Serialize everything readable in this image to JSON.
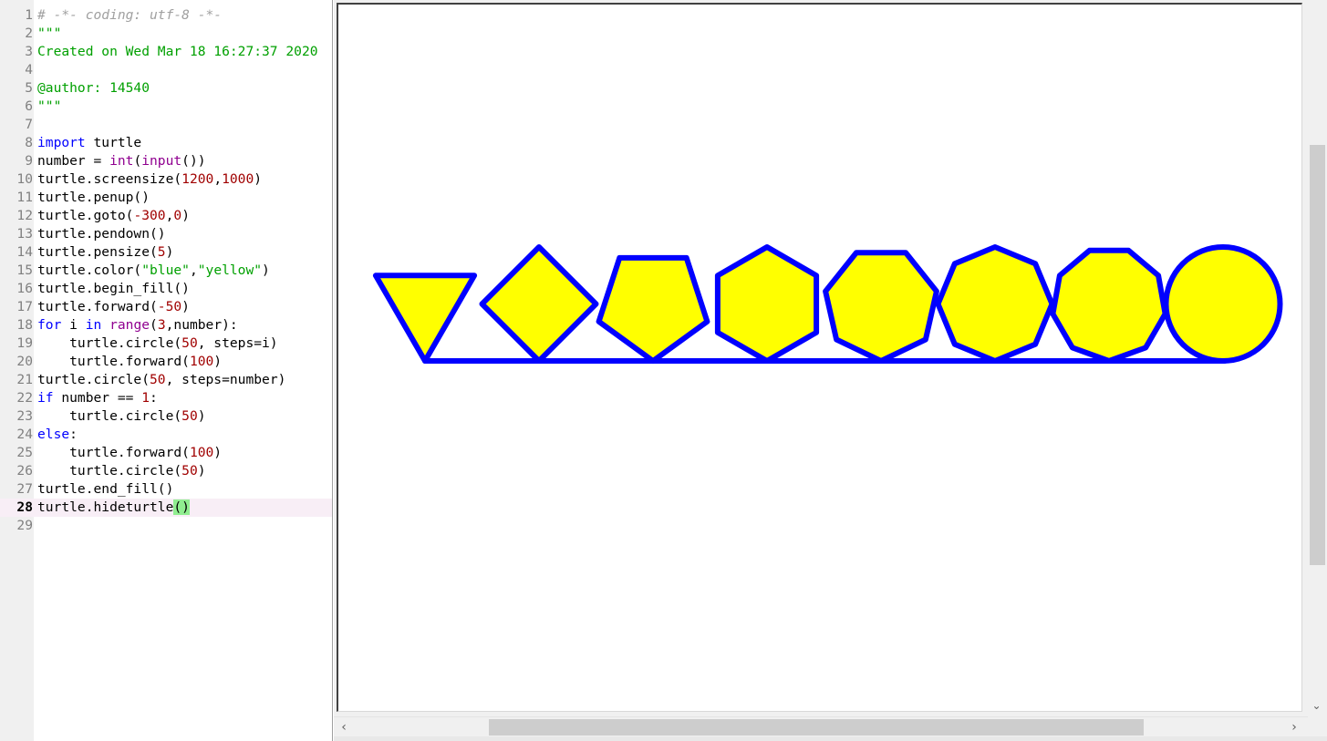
{
  "editor": {
    "current_line": 28,
    "lines": [
      {
        "n": "1",
        "tokens": [
          {
            "t": "# -*- coding: utf-8 -*-",
            "c": "comment"
          }
        ]
      },
      {
        "n": "2",
        "tokens": [
          {
            "t": "\"\"\"",
            "c": "doc"
          }
        ]
      },
      {
        "n": "3",
        "tokens": [
          {
            "t": "Created on Wed Mar 18 16:27:37 2020",
            "c": "doc"
          }
        ]
      },
      {
        "n": "4",
        "tokens": []
      },
      {
        "n": "5",
        "tokens": [
          {
            "t": "@author: 14540",
            "c": "doc"
          }
        ]
      },
      {
        "n": "6",
        "tokens": [
          {
            "t": "\"\"\"",
            "c": "doc"
          }
        ]
      },
      {
        "n": "7",
        "tokens": []
      },
      {
        "n": "8",
        "tokens": [
          {
            "t": "import",
            "c": "kw"
          },
          {
            "t": " turtle",
            "c": "plain"
          }
        ]
      },
      {
        "n": "9",
        "tokens": [
          {
            "t": "number = ",
            "c": "plain"
          },
          {
            "t": "int",
            "c": "builtin"
          },
          {
            "t": "(",
            "c": "plain"
          },
          {
            "t": "input",
            "c": "builtin"
          },
          {
            "t": "())",
            "c": "plain"
          }
        ]
      },
      {
        "n": "10",
        "tokens": [
          {
            "t": "turtle.screensize(",
            "c": "plain"
          },
          {
            "t": "1200",
            "c": "num"
          },
          {
            "t": ",",
            "c": "plain"
          },
          {
            "t": "1000",
            "c": "num"
          },
          {
            "t": ")",
            "c": "plain"
          }
        ]
      },
      {
        "n": "11",
        "tokens": [
          {
            "t": "turtle.penup()",
            "c": "plain"
          }
        ]
      },
      {
        "n": "12",
        "tokens": [
          {
            "t": "turtle.goto(",
            "c": "plain"
          },
          {
            "t": "-300",
            "c": "num"
          },
          {
            "t": ",",
            "c": "plain"
          },
          {
            "t": "0",
            "c": "num"
          },
          {
            "t": ")",
            "c": "plain"
          }
        ]
      },
      {
        "n": "13",
        "tokens": [
          {
            "t": "turtle.pendown()",
            "c": "plain"
          }
        ]
      },
      {
        "n": "14",
        "tokens": [
          {
            "t": "turtle.pensize(",
            "c": "plain"
          },
          {
            "t": "5",
            "c": "num"
          },
          {
            "t": ")",
            "c": "plain"
          }
        ]
      },
      {
        "n": "15",
        "tokens": [
          {
            "t": "turtle.color(",
            "c": "plain"
          },
          {
            "t": "\"blue\"",
            "c": "str"
          },
          {
            "t": ",",
            "c": "plain"
          },
          {
            "t": "\"yellow\"",
            "c": "str"
          },
          {
            "t": ")",
            "c": "plain"
          }
        ]
      },
      {
        "n": "16",
        "tokens": [
          {
            "t": "turtle.begin_fill()",
            "c": "plain"
          }
        ]
      },
      {
        "n": "17",
        "tokens": [
          {
            "t": "turtle.forward(",
            "c": "plain"
          },
          {
            "t": "-50",
            "c": "num"
          },
          {
            "t": ")",
            "c": "plain"
          }
        ]
      },
      {
        "n": "18",
        "tokens": [
          {
            "t": "for",
            "c": "kw"
          },
          {
            "t": " i ",
            "c": "plain"
          },
          {
            "t": "in",
            "c": "kw"
          },
          {
            "t": " ",
            "c": "plain"
          },
          {
            "t": "range",
            "c": "builtin"
          },
          {
            "t": "(",
            "c": "plain"
          },
          {
            "t": "3",
            "c": "num"
          },
          {
            "t": ",number):",
            "c": "plain"
          }
        ]
      },
      {
        "n": "19",
        "tokens": [
          {
            "t": "    turtle.circle(",
            "c": "plain"
          },
          {
            "t": "50",
            "c": "num"
          },
          {
            "t": ", steps=i)",
            "c": "plain"
          }
        ]
      },
      {
        "n": "20",
        "tokens": [
          {
            "t": "    turtle.forward(",
            "c": "plain"
          },
          {
            "t": "100",
            "c": "num"
          },
          {
            "t": ")",
            "c": "plain"
          }
        ]
      },
      {
        "n": "21",
        "tokens": [
          {
            "t": "turtle.circle(",
            "c": "plain"
          },
          {
            "t": "50",
            "c": "num"
          },
          {
            "t": ", steps=number)",
            "c": "plain"
          }
        ]
      },
      {
        "n": "22",
        "tokens": [
          {
            "t": "if",
            "c": "kw"
          },
          {
            "t": " number == ",
            "c": "plain"
          },
          {
            "t": "1",
            "c": "num"
          },
          {
            "t": ":",
            "c": "plain"
          }
        ]
      },
      {
        "n": "23",
        "tokens": [
          {
            "t": "    turtle.circle(",
            "c": "plain"
          },
          {
            "t": "50",
            "c": "num"
          },
          {
            "t": ")",
            "c": "plain"
          }
        ]
      },
      {
        "n": "24",
        "tokens": [
          {
            "t": "else",
            "c": "kw"
          },
          {
            "t": ":",
            "c": "plain"
          }
        ]
      },
      {
        "n": "25",
        "tokens": [
          {
            "t": "    turtle.forward(",
            "c": "plain"
          },
          {
            "t": "100",
            "c": "num"
          },
          {
            "t": ")",
            "c": "plain"
          }
        ]
      },
      {
        "n": "26",
        "tokens": [
          {
            "t": "    turtle.circle(",
            "c": "plain"
          },
          {
            "t": "50",
            "c": "num"
          },
          {
            "t": ")",
            "c": "plain"
          }
        ]
      },
      {
        "n": "27",
        "tokens": [
          {
            "t": "turtle.end_fill()",
            "c": "plain"
          }
        ]
      },
      {
        "n": "28",
        "tokens": [
          {
            "t": "turtle.hideturtle",
            "c": "plain"
          },
          {
            "t": "()",
            "c": "brace"
          }
        ]
      },
      {
        "n": "29",
        "tokens": []
      }
    ]
  },
  "turtle": {
    "pen_color": "#0000ff",
    "fill_color": "#ffff00",
    "shapes": [
      {
        "name": "triangle-shape",
        "steps": 3
      },
      {
        "name": "square-shape",
        "steps": 4
      },
      {
        "name": "pentagon-shape",
        "steps": 5
      },
      {
        "name": "hexagon-shape",
        "steps": 6
      },
      {
        "name": "heptagon-shape",
        "steps": 7
      },
      {
        "name": "octagon-shape",
        "steps": 8
      },
      {
        "name": "nonagon-shape",
        "steps": 9
      },
      {
        "name": "circle-shape",
        "steps": 0
      }
    ]
  },
  "scrollbars": {
    "left_arrow": "‹",
    "right_arrow": "›",
    "down_arrow": "⌄"
  }
}
